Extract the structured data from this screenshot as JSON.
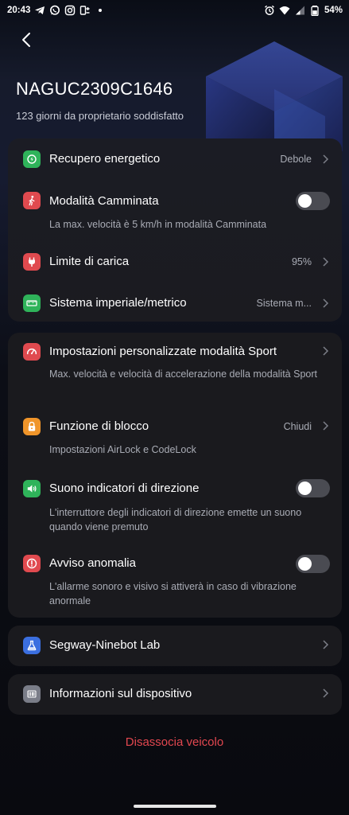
{
  "status_bar": {
    "time": "20:43",
    "battery": "54%",
    "left_icons": [
      "telegram-icon",
      "whatsapp-icon",
      "instagram-icon",
      "shortcut-icon",
      "dot-icon"
    ],
    "right_icons": [
      "alarm-icon",
      "wifi-icon",
      "signal-icon",
      "battery-icon"
    ]
  },
  "header": {
    "device_name": "NAGUC2309C1646",
    "owner_days": "123 giorni da proprietario soddisfatto"
  },
  "group1": [
    {
      "title": "Recupero energetico",
      "value": "Debole",
      "icon": "energy-recovery-icon",
      "color": "#2fb35a"
    },
    {
      "title": "Modalità Camminata",
      "desc": "La max. velocità è 5 km/h in modalità Camminata",
      "icon": "walk-icon",
      "color": "#e04a4f",
      "toggle": false
    },
    {
      "title": "Limite di carica",
      "value": "95%",
      "icon": "plug-icon",
      "color": "#e04a4f"
    },
    {
      "title": "Sistema imperiale/metrico",
      "value": "Sistema m...",
      "icon": "ruler-icon",
      "color": "#2fb35a"
    }
  ],
  "group2": [
    {
      "title": "Impostazioni personalizzate modalità Sport",
      "desc": "Max. velocità e velocità di accelerazione della modalità Sport",
      "icon": "speedometer-icon",
      "color": "#e04a4f"
    },
    {
      "title": "Funzione di blocco",
      "value": "Chiudi",
      "desc": "Impostazioni AirLock e CodeLock",
      "icon": "lock-icon",
      "color": "#f0952a"
    },
    {
      "title": "Suono indicatori di direzione",
      "desc": "L'interruttore degli indicatori di direzione emette un suono quando viene premuto",
      "icon": "speaker-icon",
      "color": "#2fb35a",
      "toggle": false
    },
    {
      "title": "Avviso anomalia",
      "desc": "L'allarme sonoro e visivo si attiverà in caso di vibrazione anormale",
      "icon": "alert-icon",
      "color": "#e04a4f",
      "toggle": false
    }
  ],
  "lab": {
    "title": "Segway-Ninebot Lab",
    "icon": "flask-icon",
    "color": "#3b6fe0"
  },
  "device_info": {
    "title": "Informazioni sul dispositivo",
    "icon": "barcode-icon",
    "color": "#7a7d88"
  },
  "footer": {
    "unpair_label": "Disassocia veicolo"
  }
}
